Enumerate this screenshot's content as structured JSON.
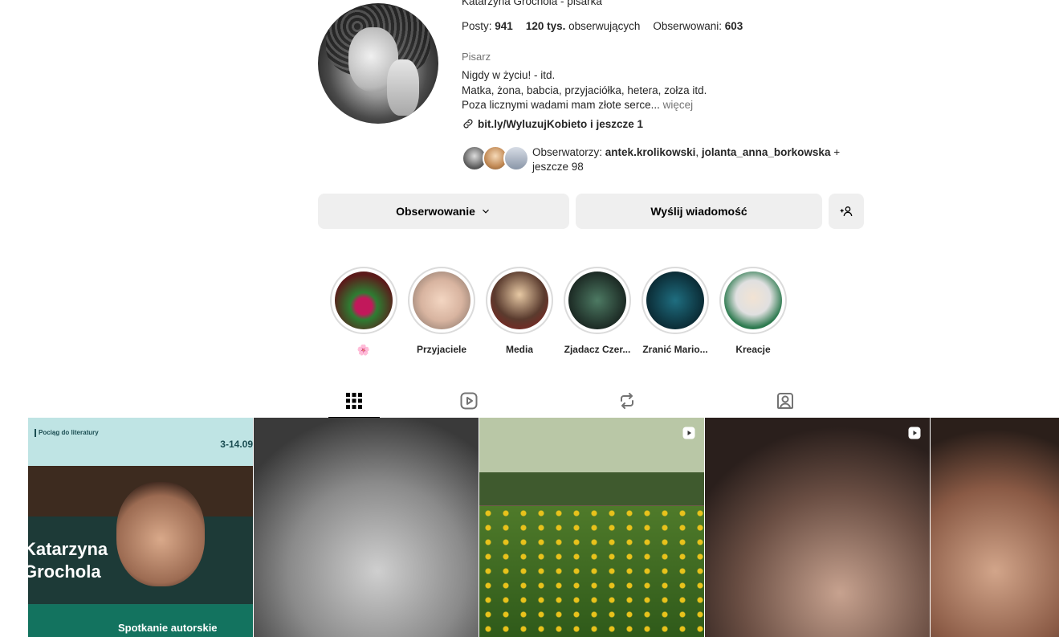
{
  "profile": {
    "name_line": "Katarzyna Grochola - pisarka",
    "stats": {
      "posts_label": "Posty:",
      "posts_value": "941",
      "followers_value": "120 tys.",
      "followers_label": "obserwujących",
      "following_label": "Obserwowani:",
      "following_value": "603"
    },
    "category": "Pisarz",
    "bio": {
      "line1": "Nigdy w życiu! - itd.",
      "line2": "Matka, żona, babcia, przyjaciółka, hetera, zołza itd.",
      "line3": "Poza licznymi wadami mam złote serce...",
      "more": "więcej"
    },
    "link": "bit.ly/WyluzujKobieto i jeszcze 1",
    "followed_by": {
      "prefix": "Obserwatorzy:",
      "user1": "antek.krolikowski",
      "separator": ",",
      "user2": "jolanta_anna_borkowska",
      "suffix": " + jeszcze 98"
    }
  },
  "actions": {
    "follow_label": "Obserwowanie",
    "message_label": "Wyślij wiadomość"
  },
  "highlights": [
    {
      "label": "🌸"
    },
    {
      "label": "Przyjaciele"
    },
    {
      "label": "Media"
    },
    {
      "label": "Zjadacz Czer..."
    },
    {
      "label": "Zranić Mario..."
    },
    {
      "label": "Kreacje"
    }
  ],
  "tabs": [
    "grid-icon",
    "reels-icon",
    "reposts-icon",
    "tagged-icon"
  ],
  "posts": {
    "p1": {
      "top_text": "Pociąg do literatury",
      "date": "3-14.09",
      "name_line1": "Katarzyna",
      "name_line2": "Grochola",
      "banner": "Spotkanie autorskie"
    }
  },
  "colors": {
    "button_bg": "#efefef",
    "text_secondary": "#737373",
    "ring": "#dbdbdb"
  }
}
